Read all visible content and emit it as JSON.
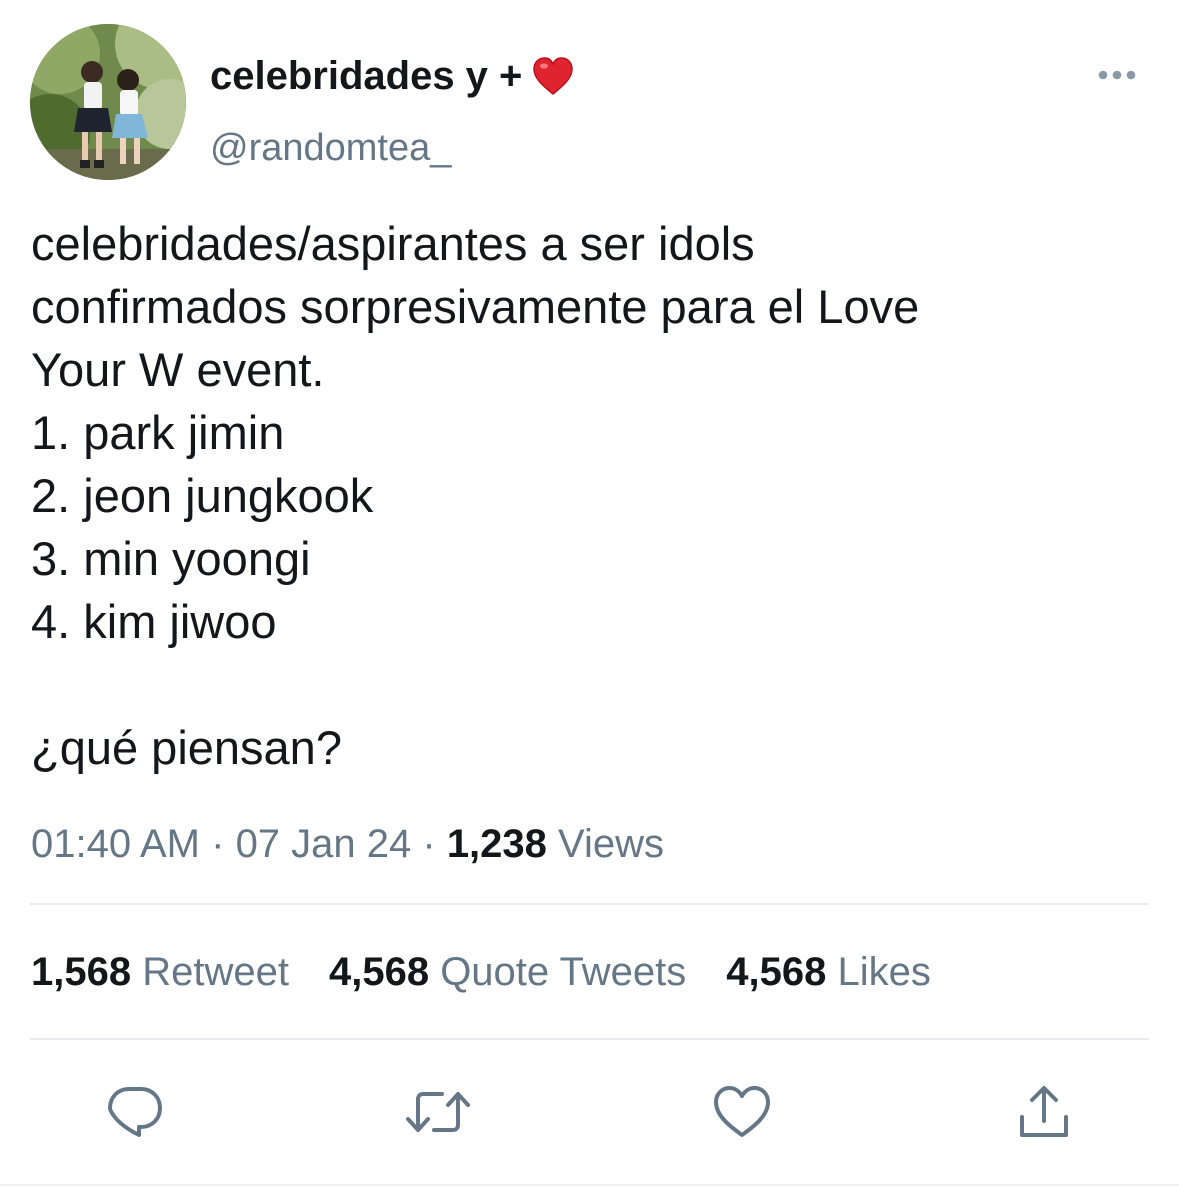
{
  "author": {
    "display_name": "celebridades y +",
    "name_emoji": "red-heart-emoji",
    "handle": "@randomtea_"
  },
  "tweet": {
    "text": "celebridades/aspirantes a ser idols\nconfirmados sorpresivamente para el Love\nYour W event.\n1. park jimin\n2. jeon jungkook\n3. min yoongi\n4. kim jiwoo\n\n¿qué piensan?"
  },
  "meta": {
    "time": "01:40 AM",
    "sep1": " · ",
    "date": "07 Jan 24",
    "sep2": " · ",
    "views_count": "1,238",
    "views_label": " Views"
  },
  "stats": [
    {
      "count": "1,568",
      "label": " Retweet"
    },
    {
      "count": "4,568",
      "label": " Quote Tweets"
    },
    {
      "count": "4,568",
      "label": " Likes"
    }
  ],
  "actions": [
    "reply-icon",
    "retweet-icon",
    "like-icon",
    "share-icon"
  ],
  "colors": {
    "text": "#14171a",
    "secondary": "#657786",
    "divider": "#e6ecf0",
    "heart": "#e0242f"
  }
}
